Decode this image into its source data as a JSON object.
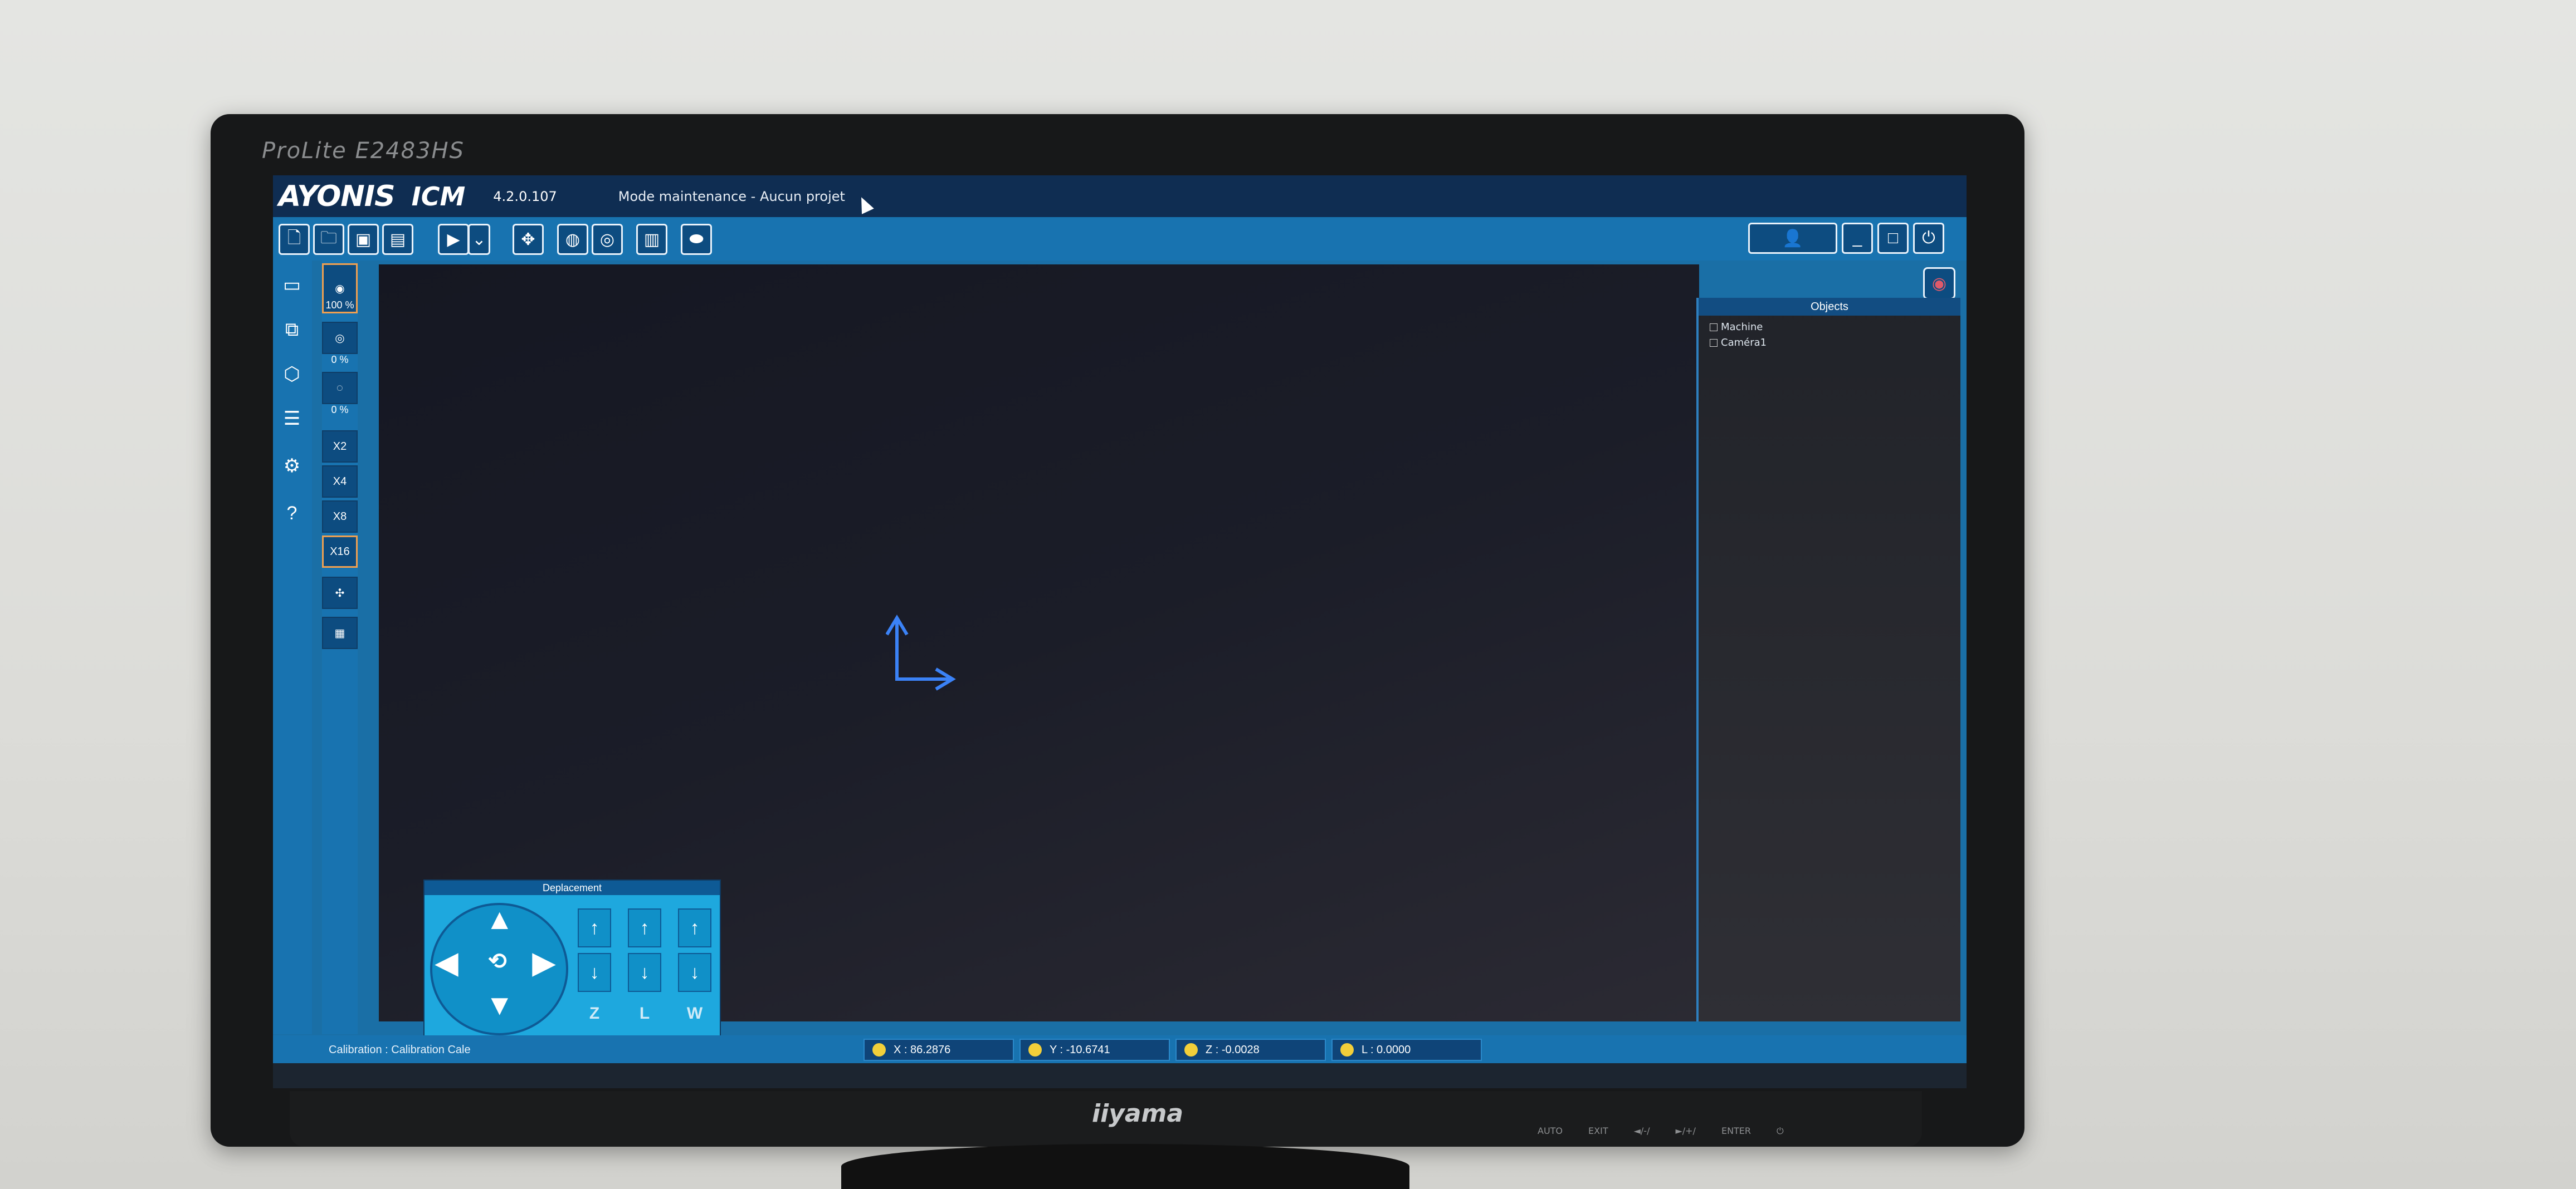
{
  "monitor": {
    "model": "ProLite E2483HS",
    "brand": "iiyama",
    "buttons": [
      "AUTO",
      "EXIT",
      "◄/-/",
      "►/+/",
      "ENTER",
      "⏻"
    ]
  },
  "app": {
    "logo": "AYONIS",
    "logo2": "ICM",
    "version": "4.2.0.107",
    "mode": "Mode maintenance - Aucun projet"
  },
  "toolbar": {
    "buttons": [
      "new-icon",
      "open-icon",
      "save-icon",
      "save-as-icon",
      "play-icon",
      "dropdown-icon",
      "move-icon",
      "globe-icon",
      "globe-arrow-icon",
      "clipboard-icon",
      "eye-icon"
    ]
  },
  "window": {
    "user_icon": "user-icon",
    "minimize": "_",
    "maximize": "□",
    "close": "⏻"
  },
  "zoom": {
    "lights": [
      {
        "pct": "100 %"
      },
      {
        "pct": "0 %"
      },
      {
        "pct": "0 %"
      }
    ],
    "levels": [
      "X2",
      "X4",
      "X8",
      "X16"
    ],
    "active_level": "X16"
  },
  "objects": {
    "title": "Objects",
    "items": [
      "Machine",
      "Caméra1"
    ]
  },
  "deplacement": {
    "title": "Deplacement",
    "axes": [
      "Z",
      "L",
      "W"
    ]
  },
  "status": {
    "calibration": "Calibration :   Calibration Cale",
    "x": "X : 86.2876",
    "y": "Y : -10.6741",
    "z": "Z : -0.0028",
    "l": "L : 0.0000"
  },
  "colors": {
    "accent": "#1873b0",
    "titlebar": "#0f2d52",
    "panel": "#1ea8de",
    "axis_arrow": "#3b82f6"
  }
}
